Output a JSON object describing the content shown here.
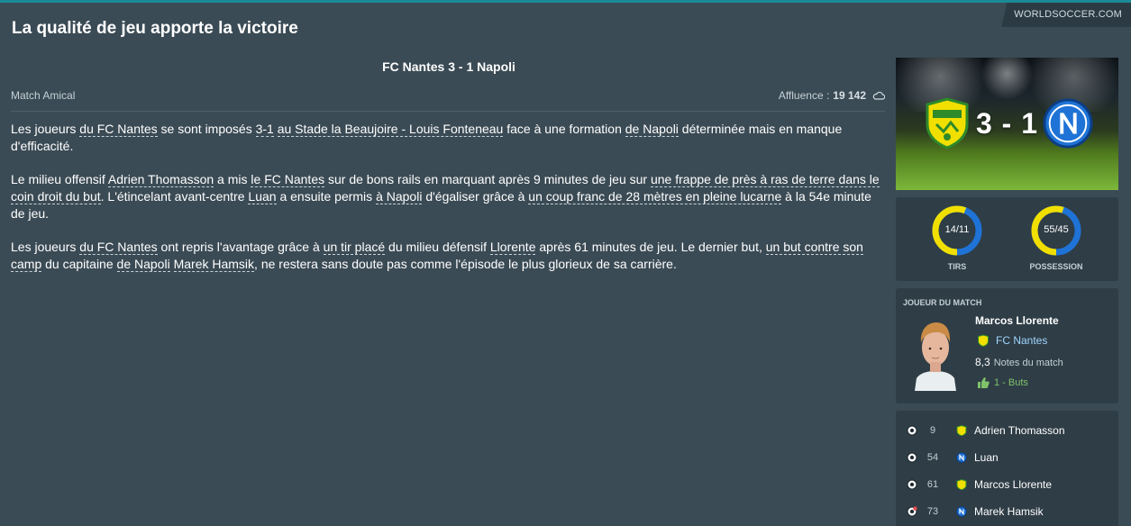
{
  "source": "WORLDSOCCER.COM",
  "headline": "La qualité de jeu apporte la victoire",
  "match": {
    "title": "FC Nantes 3 - 1  Napoli",
    "competition": "Match Amical",
    "attendance_label": "Affluence :",
    "attendance_value": "19 142",
    "weather_icon": "cloud-icon"
  },
  "article": {
    "p1": [
      {
        "t": "Les joueurs "
      },
      {
        "t": "du FC Nantes",
        "link": true
      },
      {
        "t": " se sont imposés "
      },
      {
        "t": "3-1",
        "link": true
      },
      {
        "t": " "
      },
      {
        "t": "au Stade la Beaujoire - Louis Fonteneau",
        "link": true
      },
      {
        "t": " face à une formation "
      },
      {
        "t": "de Napoli",
        "link": true
      },
      {
        "t": " déterminée mais en manque d'efficacité."
      }
    ],
    "p2": [
      {
        "t": "Le milieu offensif "
      },
      {
        "t": "Adrien Thomasson",
        "link": true
      },
      {
        "t": " a mis "
      },
      {
        "t": "le FC Nantes",
        "link": true
      },
      {
        "t": " sur de bons rails en marquant après 9 minutes de jeu sur "
      },
      {
        "t": "une frappe de près à ras de terre dans le coin droit du but",
        "link": true
      },
      {
        "t": ". L'étincelant avant-centre "
      },
      {
        "t": "Luan",
        "link": true
      },
      {
        "t": " a ensuite permis "
      },
      {
        "t": "à Napoli",
        "link": true
      },
      {
        "t": " d'égaliser grâce à "
      },
      {
        "t": "un coup franc de 28 mètres en pleine lucarne",
        "link": true
      },
      {
        "t": " à la 54e minute de jeu."
      }
    ],
    "p3": [
      {
        "t": "Les joueurs "
      },
      {
        "t": "du FC Nantes",
        "link": true
      },
      {
        "t": " ont repris l'avantage grâce à "
      },
      {
        "t": "un tir placé",
        "link": true
      },
      {
        "t": " du milieu défensif "
      },
      {
        "t": "Llorente",
        "link": true
      },
      {
        "t": " après 61 minutes de jeu. Le dernier but, "
      },
      {
        "t": "un but contre son camp",
        "link": true
      },
      {
        "t": " du capitaine "
      },
      {
        "t": "de Napoli",
        "link": true
      },
      {
        "t": " "
      },
      {
        "t": "Marek Hamsik",
        "link": true
      },
      {
        "t": ", ne restera sans doute pas comme l'épisode le plus glorieux de sa carrière."
      }
    ]
  },
  "scoreboard": {
    "score": "3 - 1",
    "home_crest": "fc-nantes-crest-icon",
    "away_crest": "napoli-crest-icon"
  },
  "stats": {
    "shots": {
      "value": "14/11",
      "label": "TIRS",
      "home_fraction": 0.56
    },
    "possession": {
      "value": "55/45",
      "label": "POSSESSION",
      "home_fraction": 0.55
    },
    "colors": {
      "home": "#f1df00",
      "away": "#1f73d6"
    }
  },
  "motm": {
    "heading": "JOUEUR DU MATCH",
    "name": "Marcos Llorente",
    "club": "FC Nantes",
    "rating": "8,3",
    "rating_label": "Notes du match",
    "goals": "1 - Buts"
  },
  "goals": [
    {
      "minute": "9",
      "player": "Adrien Thomasson",
      "club": "nantes",
      "icon": "ball-icon"
    },
    {
      "minute": "54",
      "player": "Luan",
      "club": "napoli",
      "icon": "ball-icon"
    },
    {
      "minute": "61",
      "player": "Marcos Llorente",
      "club": "nantes",
      "icon": "ball-icon"
    },
    {
      "minute": "73",
      "player": "Marek Hamsik",
      "club": "napoli",
      "icon": "own-goal-ball-icon"
    }
  ]
}
